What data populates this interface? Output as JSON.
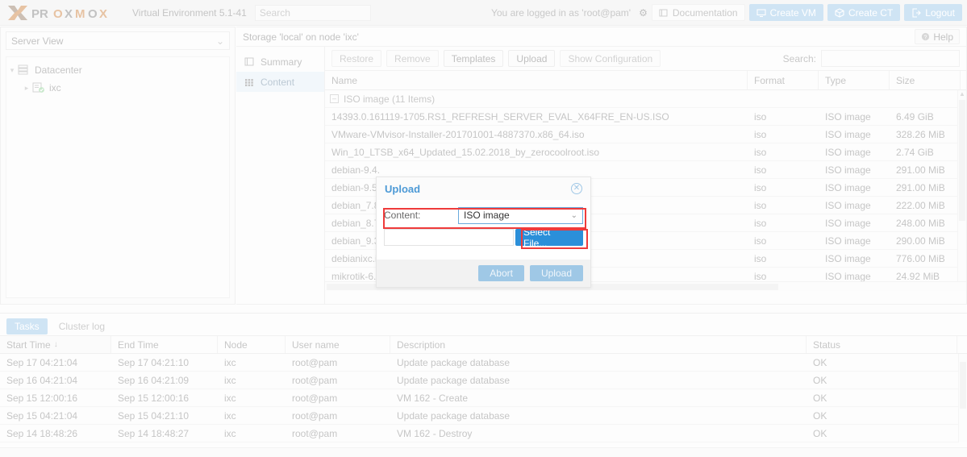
{
  "header": {
    "brand": "PROXMOX",
    "product": "Virtual Environment 5.1-41",
    "search_placeholder": "Search",
    "login_text": "You are logged in as 'root@pam'",
    "gear_icon": "gear-icon",
    "buttons": [
      {
        "label": "Documentation",
        "icon": "book-icon",
        "style": "plain"
      },
      {
        "label": "Create VM",
        "icon": "monitor-icon",
        "style": "blue"
      },
      {
        "label": "Create CT",
        "icon": "cube-icon",
        "style": "blue"
      },
      {
        "label": "Logout",
        "icon": "logout-icon",
        "style": "blue"
      }
    ]
  },
  "sidebar": {
    "view_selector": "Server View",
    "chevron_icon": "chevron-down-icon",
    "tree": [
      {
        "label": "Datacenter",
        "icon": "datacenter-icon",
        "arrow": "⌄",
        "level": 1
      },
      {
        "label": "ixc",
        "icon": "node-online-icon",
        "arrow": "›",
        "level": 2
      }
    ]
  },
  "content": {
    "breadcrumb": "Storage 'local' on node 'ixc'",
    "help_label": "Help",
    "help_icon": "question-circle-icon",
    "tabs": [
      {
        "label": "Summary",
        "icon": "book-icon",
        "active": false
      },
      {
        "label": "Content",
        "icon": "grid-icon",
        "active": true
      }
    ],
    "toolbar": [
      {
        "label": "Restore",
        "enabled": false
      },
      {
        "label": "Remove",
        "enabled": false
      },
      {
        "label": "Templates",
        "enabled": true
      },
      {
        "label": "Upload",
        "enabled": true
      },
      {
        "label": "Show Configuration",
        "enabled": false
      }
    ],
    "search_label": "Search:",
    "search_value": "",
    "columns": [
      "Name",
      "Format",
      "Type",
      "Size"
    ],
    "group_label": "ISO image (11 Items)",
    "group_collapse_icon": "minus-box-icon",
    "rows": [
      {
        "name": "14393.0.161119-1705.RS1_REFRESH_SERVER_EVAL_X64FRE_EN-US.ISO",
        "format": "iso",
        "type": "ISO image",
        "size": "6.49 GiB"
      },
      {
        "name": "VMware-VMvisor-Installer-201701001-4887370.x86_64.iso",
        "format": "iso",
        "type": "ISO image",
        "size": "328.26 MiB"
      },
      {
        "name": "Win_10_LTSB_x64_Updated_15.02.2018_by_zerocoolroot.iso",
        "format": "iso",
        "type": "ISO image",
        "size": "2.74 GiB"
      },
      {
        "name": "debian-9.4.",
        "format": "iso",
        "type": "ISO image",
        "size": "291.00 MiB"
      },
      {
        "name": "debian-9.5.",
        "format": "iso",
        "type": "ISO image",
        "size": "291.00 MiB"
      },
      {
        "name": "debian_7.8",
        "format": "iso",
        "type": "ISO image",
        "size": "222.00 MiB"
      },
      {
        "name": "debian_8.7",
        "format": "iso",
        "type": "ISO image",
        "size": "248.00 MiB"
      },
      {
        "name": "debian_9.3",
        "format": "iso",
        "type": "ISO image",
        "size": "290.00 MiB"
      },
      {
        "name": "debianixc.i",
        "format": "iso",
        "type": "ISO image",
        "size": "776.00 MiB"
      },
      {
        "name": "mikrotik-6.40.5.iso",
        "format": "iso",
        "type": "ISO image",
        "size": "24.92 MiB"
      }
    ]
  },
  "dialog": {
    "title": "Upload",
    "close_icon": "close-circle-icon",
    "content_label": "Content:",
    "content_value": "ISO image",
    "content_chevron_icon": "chevron-down-icon",
    "file_value": "",
    "select_file_label": "Select File...",
    "abort_label": "Abort",
    "upload_label": "Upload",
    "highlight_color": "#ef3b3b"
  },
  "bottom": {
    "tabs": [
      {
        "label": "Tasks",
        "active": true
      },
      {
        "label": "Cluster log",
        "active": false
      }
    ],
    "columns": [
      "Start Time",
      "End Time",
      "Node",
      "User name",
      "Description",
      "Status"
    ],
    "sort_column": "Start Time",
    "sort_icon": "↓",
    "rows": [
      {
        "start": "Sep 17 04:21:04",
        "end": "Sep 17 04:21:10",
        "node": "ixc",
        "user": "root@pam",
        "desc": "Update package database",
        "status": "OK"
      },
      {
        "start": "Sep 16 04:21:04",
        "end": "Sep 16 04:21:09",
        "node": "ixc",
        "user": "root@pam",
        "desc": "Update package database",
        "status": "OK"
      },
      {
        "start": "Sep 15 12:00:16",
        "end": "Sep 15 12:00:16",
        "node": "ixc",
        "user": "root@pam",
        "desc": "VM 162 - Create",
        "status": "OK"
      },
      {
        "start": "Sep 15 04:21:04",
        "end": "Sep 15 04:21:10",
        "node": "ixc",
        "user": "root@pam",
        "desc": "Update package database",
        "status": "OK"
      },
      {
        "start": "Sep 14 18:48:26",
        "end": "Sep 14 18:48:27",
        "node": "ixc",
        "user": "root@pam",
        "desc": "VM 162 - Destroy",
        "status": "OK"
      }
    ]
  }
}
